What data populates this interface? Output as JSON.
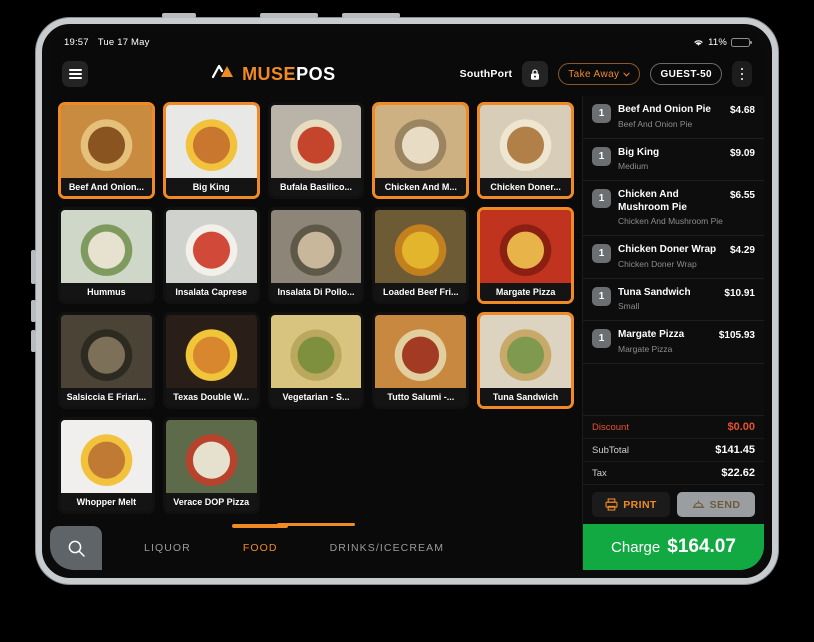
{
  "device": {
    "status_bar": {
      "time": "19:57",
      "date": "Tue 17 May",
      "battery_percent": "11%"
    }
  },
  "header": {
    "menu_icon": "hamburger-icon",
    "brand_primary": "MUSE",
    "brand_secondary": "POS",
    "store": "SouthPort",
    "lock_icon": "lock-icon",
    "order_type": "Take Away",
    "guest": "GUEST-50",
    "overflow_icon": "more-vertical-icon"
  },
  "catalog": {
    "products": [
      {
        "label": "Beef And Onion...",
        "selected": true,
        "img": "pie"
      },
      {
        "label": "Big King",
        "selected": true,
        "img": "burger"
      },
      {
        "label": "Bufala Basilico...",
        "selected": false,
        "img": "pizza-margherita"
      },
      {
        "label": "Chicken And M...",
        "selected": true,
        "img": "chicken-pie"
      },
      {
        "label": "Chicken Doner...",
        "selected": true,
        "img": "wrap"
      },
      {
        "label": "Hummus",
        "selected": false,
        "img": "hummus"
      },
      {
        "label": "Insalata Caprese",
        "selected": false,
        "img": "caprese"
      },
      {
        "label": "Insalata Di Pollo...",
        "selected": false,
        "img": "chicken-salad"
      },
      {
        "label": "Loaded Beef Fri...",
        "selected": false,
        "img": "loaded-fries"
      },
      {
        "label": "Margate Pizza",
        "selected": true,
        "img": "pepperoni-pizza"
      },
      {
        "label": "Salsiccia E Friari...",
        "selected": false,
        "img": "sausage-pizza"
      },
      {
        "label": "Texas Double W...",
        "selected": false,
        "img": "double-burger"
      },
      {
        "label": "Vegetarian - S...",
        "selected": false,
        "img": "veg-pizza"
      },
      {
        "label": "Tutto Salumi -...",
        "selected": false,
        "img": "salumi-pizza"
      },
      {
        "label": "Tuna Sandwich",
        "selected": true,
        "img": "sandwich"
      },
      {
        "label": "Whopper Melt",
        "selected": false,
        "img": "melt-burger"
      },
      {
        "label": "Verace DOP Pizza",
        "selected": false,
        "img": "dop-pizza"
      }
    ]
  },
  "bottom_nav": {
    "search_icon": "search-icon",
    "categories": [
      {
        "label": "LIQUOR",
        "active": false
      },
      {
        "label": "FOOD",
        "active": true
      },
      {
        "label": "DRINKS/ICECREAM",
        "active": false
      }
    ]
  },
  "order": {
    "items": [
      {
        "qty": "1",
        "name": "Beef And Onion Pie",
        "sub": "Beef And Onion Pie",
        "price": "$4.68"
      },
      {
        "qty": "1",
        "name": "Big King",
        "sub": "Medium",
        "price": "$9.09"
      },
      {
        "qty": "1",
        "name": "Chicken And Mushroom Pie",
        "sub": "Chicken And Mushroom Pie",
        "price": "$6.55"
      },
      {
        "qty": "1",
        "name": "Chicken Doner Wrap",
        "sub": "Chicken Doner Wrap",
        "price": "$4.29"
      },
      {
        "qty": "1",
        "name": "Tuna Sandwich",
        "sub": "Small",
        "price": "$10.91"
      },
      {
        "qty": "1",
        "name": "Margate Pizza",
        "sub": "Margate Pizza",
        "price": "$105.93"
      }
    ],
    "totals": [
      {
        "label": "Discount",
        "value": "$0.00",
        "kind": "discount"
      },
      {
        "label": "SubTotal",
        "value": "$141.45",
        "kind": "normal"
      },
      {
        "label": "Tax",
        "value": "$22.62",
        "kind": "normal"
      }
    ],
    "print_label": "PRINT",
    "send_label": "SEND",
    "charge_label": "Charge",
    "charge_amount": "$164.07"
  },
  "colors": {
    "accent": "#f08a24",
    "charge": "#12a943",
    "discount": "#e8512f"
  }
}
